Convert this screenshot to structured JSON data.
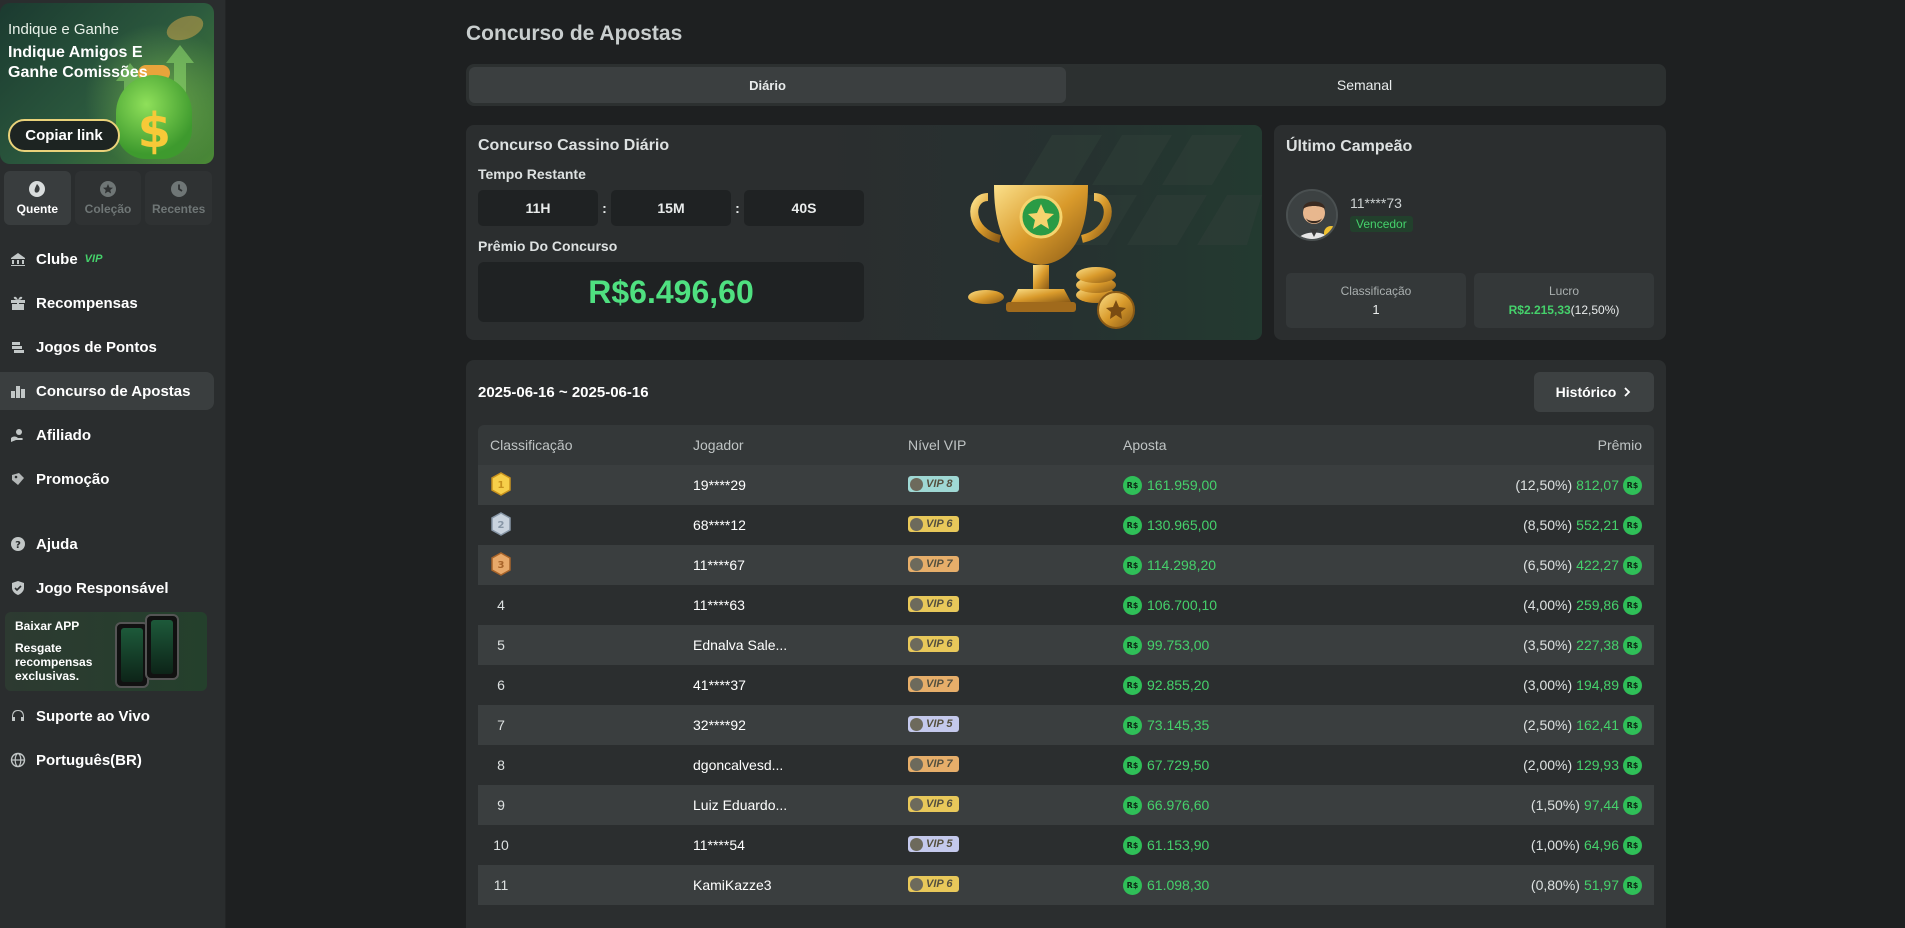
{
  "sidebar": {
    "promo": {
      "line1": "Indique e Ganhe",
      "line2": "Indique Amigos E Ganhe Comissões",
      "button": "Copiar link"
    },
    "cat_tabs": [
      {
        "label": "Quente",
        "icon": "hot-icon",
        "active": true
      },
      {
        "label": "Coleção",
        "icon": "star-icon",
        "active": false
      },
      {
        "label": "Recentes",
        "icon": "clock-icon",
        "active": false
      }
    ],
    "nav": [
      {
        "label": "Clube",
        "extra": "VIP",
        "icon": "club-icon"
      },
      {
        "label": "Recompensas",
        "icon": "gift-icon"
      },
      {
        "label": "Jogos de Pontos",
        "icon": "points-icon"
      },
      {
        "label": "Concurso de Apostas",
        "icon": "podium-icon",
        "active": true
      },
      {
        "label": "Afiliado",
        "icon": "affiliate-icon"
      },
      {
        "label": "Promoção",
        "icon": "promo-icon"
      },
      {
        "label": "Ajuda",
        "icon": "help-icon"
      },
      {
        "label": "Jogo Responsável",
        "icon": "shield-icon"
      },
      {
        "label": "Suporte ao Vivo",
        "icon": "headset-icon"
      },
      {
        "label": "Português(BR)",
        "icon": "globe-icon"
      }
    ],
    "app_promo": {
      "title": "Baixar APP",
      "text": "Resgate recompensas exclusivas."
    }
  },
  "page": {
    "title": "Concurso de Apostas",
    "tabs": [
      {
        "label": "Diário",
        "active": true
      },
      {
        "label": "Semanal",
        "active": false
      }
    ]
  },
  "contest": {
    "title": "Concurso Cassino Diário",
    "time_label": "Tempo Restante",
    "hours": "11H",
    "minutes": "15M",
    "seconds": "40S",
    "separator": ":",
    "prize_label": "Prêmio Do Concurso",
    "prize": "R$6.496,60"
  },
  "champion": {
    "title": "Último Campeão",
    "name": "11****73",
    "badge": "Vencedor",
    "rank_label": "Classificação",
    "rank": "1",
    "profit_label": "Lucro",
    "profit": "R$2.215,33",
    "profit_pct": "(12,50%)"
  },
  "ranking": {
    "date_range": "2025-06-16 ~ 2025-06-16",
    "history_button": "Histórico",
    "headers": [
      "Classificação",
      "Jogador",
      "Nível VIP",
      "Aposta",
      "Prêmio"
    ],
    "currency_icon": "R$",
    "rows": [
      {
        "rank": "1",
        "medal": "gold",
        "player": "19****29",
        "vip": "VIP 8",
        "vip_color": "#9fd8d4",
        "bet": "161.959,00",
        "pct": "(12,50%)",
        "prize": "812,07"
      },
      {
        "rank": "2",
        "medal": "silver",
        "player": "68****12",
        "vip": "VIP 6",
        "vip_color": "#e8c85a",
        "bet": "130.965,00",
        "pct": "(8,50%)",
        "prize": "552,21"
      },
      {
        "rank": "3",
        "medal": "bronze",
        "player": "11****67",
        "vip": "VIP 7",
        "vip_color": "#e6ae6a",
        "bet": "114.298,20",
        "pct": "(6,50%)",
        "prize": "422,27"
      },
      {
        "rank": "4",
        "player": "11****63",
        "vip": "VIP 6",
        "vip_color": "#e8c85a",
        "bet": "106.700,10",
        "pct": "(4,00%)",
        "prize": "259,86"
      },
      {
        "rank": "5",
        "player": "Ednalva Sale...",
        "vip": "VIP 6",
        "vip_color": "#e8c85a",
        "bet": "99.753,00",
        "pct": "(3,50%)",
        "prize": "227,38"
      },
      {
        "rank": "6",
        "player": "41****37",
        "vip": "VIP 7",
        "vip_color": "#e6ae6a",
        "bet": "92.855,20",
        "pct": "(3,00%)",
        "prize": "194,89"
      },
      {
        "rank": "7",
        "player": "32****92",
        "vip": "VIP 5",
        "vip_color": "#c4c9ec",
        "bet": "73.145,35",
        "pct": "(2,50%)",
        "prize": "162,41"
      },
      {
        "rank": "8",
        "player": "dgoncalvesd...",
        "vip": "VIP 7",
        "vip_color": "#e6ae6a",
        "bet": "67.729,50",
        "pct": "(2,00%)",
        "prize": "129,93"
      },
      {
        "rank": "9",
        "player": "Luiz Eduardo...",
        "vip": "VIP 6",
        "vip_color": "#e8c85a",
        "bet": "66.976,60",
        "pct": "(1,50%)",
        "prize": "97,44"
      },
      {
        "rank": "10",
        "player": "11****54",
        "vip": "VIP 5",
        "vip_color": "#c4c9ec",
        "bet": "61.153,90",
        "pct": "(1,00%)",
        "prize": "64,96"
      },
      {
        "rank": "11",
        "player": "KamiKazze3",
        "vip": "VIP 6",
        "vip_color": "#e8c85a",
        "bet": "61.098,30",
        "pct": "(0,80%)",
        "prize": "51,97"
      }
    ]
  },
  "colors": {
    "accent_green": "#45d16b",
    "bg": "#1e2021",
    "panel": "#2b2e2f"
  }
}
